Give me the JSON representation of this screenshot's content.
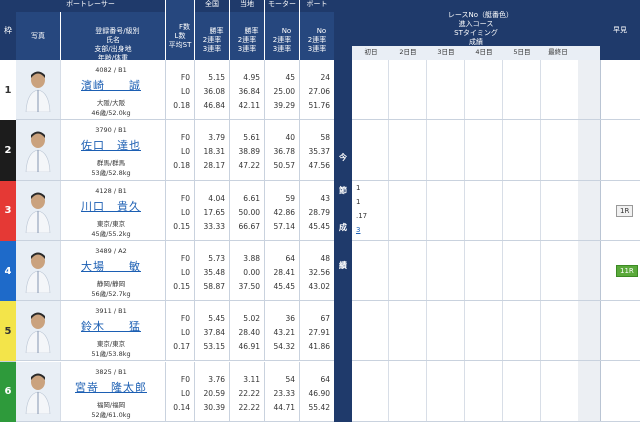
{
  "headers": {
    "waku": "枠",
    "photo": "写真",
    "racer_group": "ボートレーサー",
    "racer_sub": "登録番号/級別\n氏名\n支部/出身地\n年齢/体重",
    "f_l_st": "F数\nL数\n平均ST",
    "zenkoku_top": "全国",
    "zenkoku": "勝率\n2連率\n3連率",
    "touchi_top": "当地",
    "touchi": "勝率\n2連率\n3連率",
    "motor_top": "モーター",
    "motor": "No\n2連率\n3連率",
    "boat_top": "ボート",
    "boat": "No\n2連率\n3連率",
    "race_no": "レースNo（艇番色）\n進入コース\nSTタイミング\n成績",
    "hayami": "早見",
    "days": [
      "初日",
      "2日目",
      "3日目",
      "4日目",
      "5日目",
      "最終日"
    ],
    "konsetsu": [
      "今",
      "節",
      "成",
      "績"
    ]
  },
  "racers": [
    {
      "waku": "1",
      "reg": "4082 / B1",
      "name": "濱崎　　誠",
      "branch": "大阪/大阪",
      "age": "46歳/52.0kg",
      "f": "F0",
      "l": "L0",
      "st": "0.18",
      "z1": "5.15",
      "z2": "36.08",
      "z3": "46.84",
      "t1": "4.95",
      "t2": "36.84",
      "t3": "42.11",
      "m1": "45",
      "m2": "25.00",
      "m3": "39.29",
      "b1": "24",
      "b2": "27.06",
      "b3": "51.76",
      "results": [],
      "hayami": ""
    },
    {
      "waku": "2",
      "reg": "3790 / B1",
      "name": "佐口　達也",
      "branch": "群馬/群馬",
      "age": "53歳/52.8kg",
      "f": "F0",
      "l": "L0",
      "st": "0.18",
      "z1": "3.79",
      "z2": "18.31",
      "z3": "28.17",
      "t1": "5.61",
      "t2": "38.89",
      "t3": "47.22",
      "m1": "40",
      "m2": "36.78",
      "m3": "50.57",
      "b1": "58",
      "b2": "35.37",
      "b3": "47.56",
      "results": [],
      "hayami": ""
    },
    {
      "waku": "3",
      "reg": "4128 / B1",
      "name": "川口　貴久",
      "branch": "東京/東京",
      "age": "45歳/55.2kg",
      "f": "F0",
      "l": "L0",
      "st": "0.15",
      "z1": "4.04",
      "z2": "17.65",
      "z3": "33.33",
      "t1": "6.61",
      "t2": "50.00",
      "t3": "66.67",
      "m1": "59",
      "m2": "42.86",
      "m3": "57.14",
      "b1": "43",
      "b2": "28.79",
      "b3": "45.45",
      "results": [
        "1",
        "1",
        ".17",
        "3"
      ],
      "hayami": "1R"
    },
    {
      "waku": "4",
      "reg": "3489 / A2",
      "name": "大場　　敏",
      "branch": "静岡/静岡",
      "age": "56歳/52.7kg",
      "f": "F0",
      "l": "L0",
      "st": "0.15",
      "z1": "5.73",
      "z2": "35.48",
      "z3": "58.87",
      "t1": "3.88",
      "t2": "0.00",
      "t3": "37.50",
      "m1": "64",
      "m2": "28.41",
      "m3": "45.45",
      "b1": "48",
      "b2": "32.56",
      "b3": "43.02",
      "results": [],
      "hayami": "11R"
    },
    {
      "waku": "5",
      "reg": "3911 / B1",
      "name": "鈴木　　猛",
      "branch": "東京/東京",
      "age": "51歳/53.8kg",
      "f": "F0",
      "l": "L0",
      "st": "0.17",
      "z1": "5.45",
      "z2": "37.84",
      "z3": "53.15",
      "t1": "5.02",
      "t2": "28.40",
      "t3": "46.91",
      "m1": "36",
      "m2": "43.21",
      "m3": "54.32",
      "b1": "67",
      "b2": "27.91",
      "b3": "41.86",
      "results": [],
      "hayami": ""
    },
    {
      "waku": "6",
      "reg": "3825 / B1",
      "name": "宮嵜　隆太郎",
      "branch": "福岡/福岡",
      "age": "52歳/61.0kg",
      "f": "F0",
      "l": "L0",
      "st": "0.14",
      "z1": "3.76",
      "z2": "20.59",
      "z3": "30.39",
      "t1": "3.11",
      "t2": "22.22",
      "t3": "22.22",
      "m1": "54",
      "m2": "23.33",
      "m3": "44.71",
      "b1": "64",
      "b2": "46.90",
      "b3": "55.42",
      "results": [],
      "hayami": ""
    }
  ],
  "colors": {
    "navy": "#1f3a6b",
    "w1": "#ffffff",
    "w2": "#1c1c1c",
    "w3": "#e53935",
    "w4": "#1e6ac9",
    "w5": "#f3e44a",
    "w6": "#2e9a3b"
  }
}
